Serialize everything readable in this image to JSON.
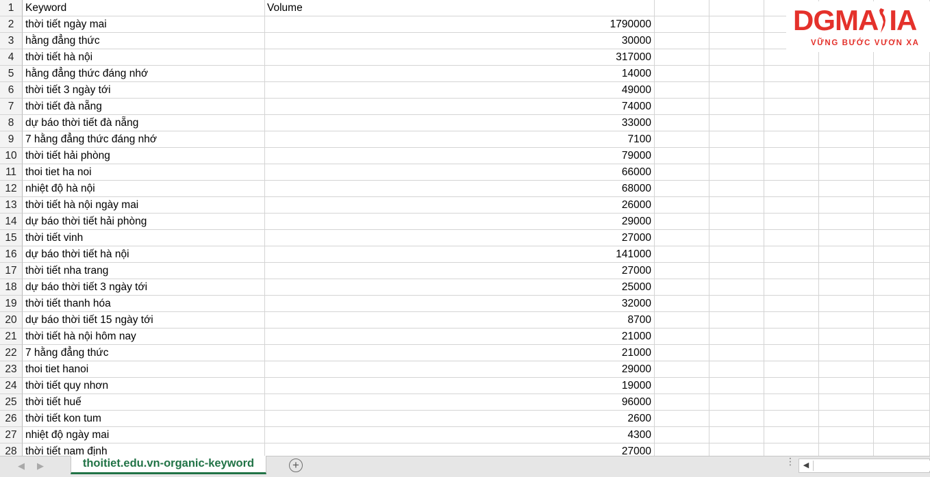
{
  "sheet": {
    "headers": [
      "Keyword",
      "Volume"
    ],
    "rows": [
      {
        "num": "1",
        "keyword": "Keyword",
        "volume": "Volume",
        "header": true
      },
      {
        "num": "2",
        "keyword": "thời tiết ngày mai",
        "volume": "1790000"
      },
      {
        "num": "3",
        "keyword": "hằng đẳng thức",
        "volume": "30000"
      },
      {
        "num": "4",
        "keyword": "thời tiết hà nội",
        "volume": "317000"
      },
      {
        "num": "5",
        "keyword": "hằng đẳng thức đáng nhớ",
        "volume": "14000"
      },
      {
        "num": "6",
        "keyword": "thời tiết 3 ngày tới",
        "volume": "49000"
      },
      {
        "num": "7",
        "keyword": "thời tiết đà nẵng",
        "volume": "74000"
      },
      {
        "num": "8",
        "keyword": "dự báo thời tiết đà nẵng",
        "volume": "33000"
      },
      {
        "num": "9",
        "keyword": "7 hằng đẳng thức đáng nhớ",
        "volume": "7100"
      },
      {
        "num": "10",
        "keyword": "thời tiết hải phòng",
        "volume": "79000"
      },
      {
        "num": "11",
        "keyword": "thoi tiet ha noi",
        "volume": "66000"
      },
      {
        "num": "12",
        "keyword": "nhiệt độ hà nội",
        "volume": "68000"
      },
      {
        "num": "13",
        "keyword": "thời tiết hà nội ngày mai",
        "volume": "26000"
      },
      {
        "num": "14",
        "keyword": "dự báo thời tiết hải phòng",
        "volume": "29000"
      },
      {
        "num": "15",
        "keyword": "thời tiết vinh",
        "volume": "27000"
      },
      {
        "num": "16",
        "keyword": "dự báo thời tiết hà nội",
        "volume": "141000"
      },
      {
        "num": "17",
        "keyword": "thời tiết nha trang",
        "volume": "27000"
      },
      {
        "num": "18",
        "keyword": "dự báo thời tiết 3 ngày tới",
        "volume": "25000"
      },
      {
        "num": "19",
        "keyword": "thời tiết thanh hóa",
        "volume": "32000"
      },
      {
        "num": "20",
        "keyword": "dự báo thời tiết 15 ngày tới",
        "volume": "8700"
      },
      {
        "num": "21",
        "keyword": "thời tiết hà nội hôm nay",
        "volume": "21000"
      },
      {
        "num": "22",
        "keyword": "7 hằng đẳng thức",
        "volume": "21000"
      },
      {
        "num": "23",
        "keyword": "thoi tiet hanoi",
        "volume": "29000"
      },
      {
        "num": "24",
        "keyword": "thời tiết quy nhơn",
        "volume": "19000"
      },
      {
        "num": "25",
        "keyword": "thời tiết huế",
        "volume": "96000"
      },
      {
        "num": "26",
        "keyword": "thời tiết kon tum",
        "volume": "2600"
      },
      {
        "num": "27",
        "keyword": "nhiệt độ ngày mai",
        "volume": "4300"
      },
      {
        "num": "28",
        "keyword": "thời tiết nam định",
        "volume": "27000"
      }
    ]
  },
  "logo": {
    "brand": "DGMAIA",
    "brand_left": "DGMA",
    "brand_right": "IA",
    "tagline": "VỮNG BƯỚC VƯƠN XA",
    "color": "#e4312b"
  },
  "tabs": {
    "active_sheet": "thoitiet.edu.vn-organic-keyword",
    "accent_color": "#217346",
    "add_icon": "plus-circle-icon",
    "prev_icon": "chevron-left-icon",
    "next_icon": "chevron-right-icon"
  }
}
